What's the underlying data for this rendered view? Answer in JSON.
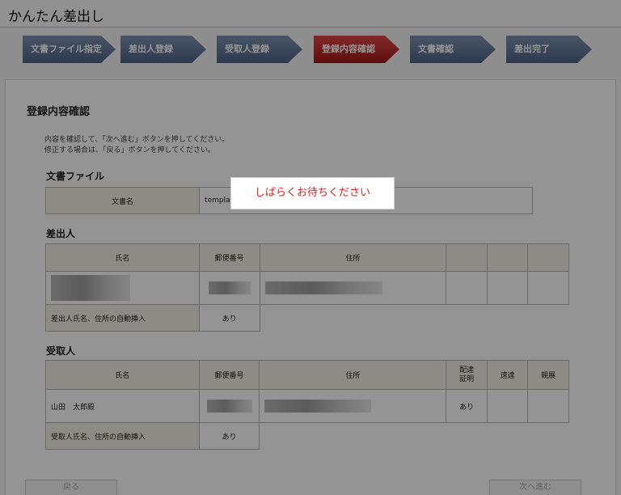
{
  "app_title": "かんたん差出し",
  "steps": [
    {
      "label": "文書ファイル指定"
    },
    {
      "label": "差出人登録"
    },
    {
      "label": "受取人登録"
    },
    {
      "label": "登録内容確認"
    },
    {
      "label": "文書確認"
    },
    {
      "label": "差出完了"
    }
  ],
  "page_heading": "登録内容確認",
  "instructions": [
    "内容を確認して、「次へ進む」ボタンを押してください。",
    "修正する場合は、「戻る」ボタンを押してください。"
  ],
  "document_file": {
    "section_title": "文書ファイル",
    "label": "文書名",
    "value": "templat"
  },
  "sender": {
    "section_title": "差出人",
    "headers": [
      "氏名",
      "郵便番号",
      "住所"
    ],
    "auto_insert_label": "差出人氏名、住所の自動挿入",
    "auto_insert_value": "あり"
  },
  "recipient": {
    "section_title": "受取人",
    "headers": [
      "氏名",
      "郵便番号",
      "住所",
      "配達\n証明",
      "速達",
      "親展"
    ],
    "name": "山田　太郎殿",
    "delivery_cert": "あり",
    "auto_insert_label": "受取人氏名、住所の自動挿入",
    "auto_insert_value": "あり"
  },
  "buttons": {
    "back": "戻る",
    "next": "次へ進む"
  },
  "loading_message": "しばらくお待ちください",
  "colors": {
    "step_normal": "#5a7093",
    "step_active": "#c02020",
    "loading_text": "#e02020"
  }
}
